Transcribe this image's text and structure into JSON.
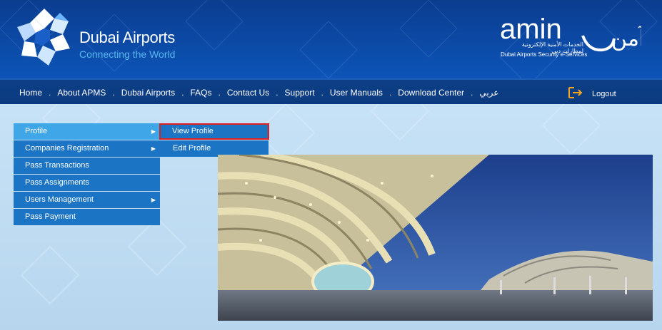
{
  "header": {
    "brand_title": "Dubai Airports",
    "brand_tagline": "Connecting the World",
    "amin_logo_text": "amin",
    "amin_logo_arabic": "آمن",
    "amin_subtitle_ar": "الخدمات الأمنية الإلكترونية لمطارات دبي",
    "amin_subtitle_en": "Dubai Airports Security e-Services"
  },
  "nav": {
    "items": [
      {
        "label": "Home"
      },
      {
        "label": "About APMS"
      },
      {
        "label": "Dubai Airports"
      },
      {
        "label": "FAQs"
      },
      {
        "label": "Contact Us"
      },
      {
        "label": "Support"
      },
      {
        "label": "User Manuals"
      },
      {
        "label": "Download Center"
      },
      {
        "label": "عربي"
      }
    ],
    "separator": ".",
    "logout_label": "Logout"
  },
  "menu": {
    "items": [
      {
        "label": "Profile",
        "has_submenu": true
      },
      {
        "label": "Companies Registration",
        "has_submenu": true
      },
      {
        "label": "Pass Transactions",
        "has_submenu": false
      },
      {
        "label": "Pass Assignments",
        "has_submenu": false
      },
      {
        "label": "Users Management",
        "has_submenu": true
      },
      {
        "label": "Pass Payment",
        "has_submenu": false
      }
    ],
    "arrow_glyph": "▶"
  },
  "submenu": {
    "items": [
      {
        "label": "View Profile"
      },
      {
        "label": "Edit Profile"
      }
    ]
  },
  "colors": {
    "header_blue": "#0c4aa6",
    "nav_blue": "#0b3a7e",
    "menu_blue": "#1b74c4",
    "menu_active": "#3fa6e7",
    "highlight_red": "#e02020",
    "logout_orange": "#f5a623"
  }
}
